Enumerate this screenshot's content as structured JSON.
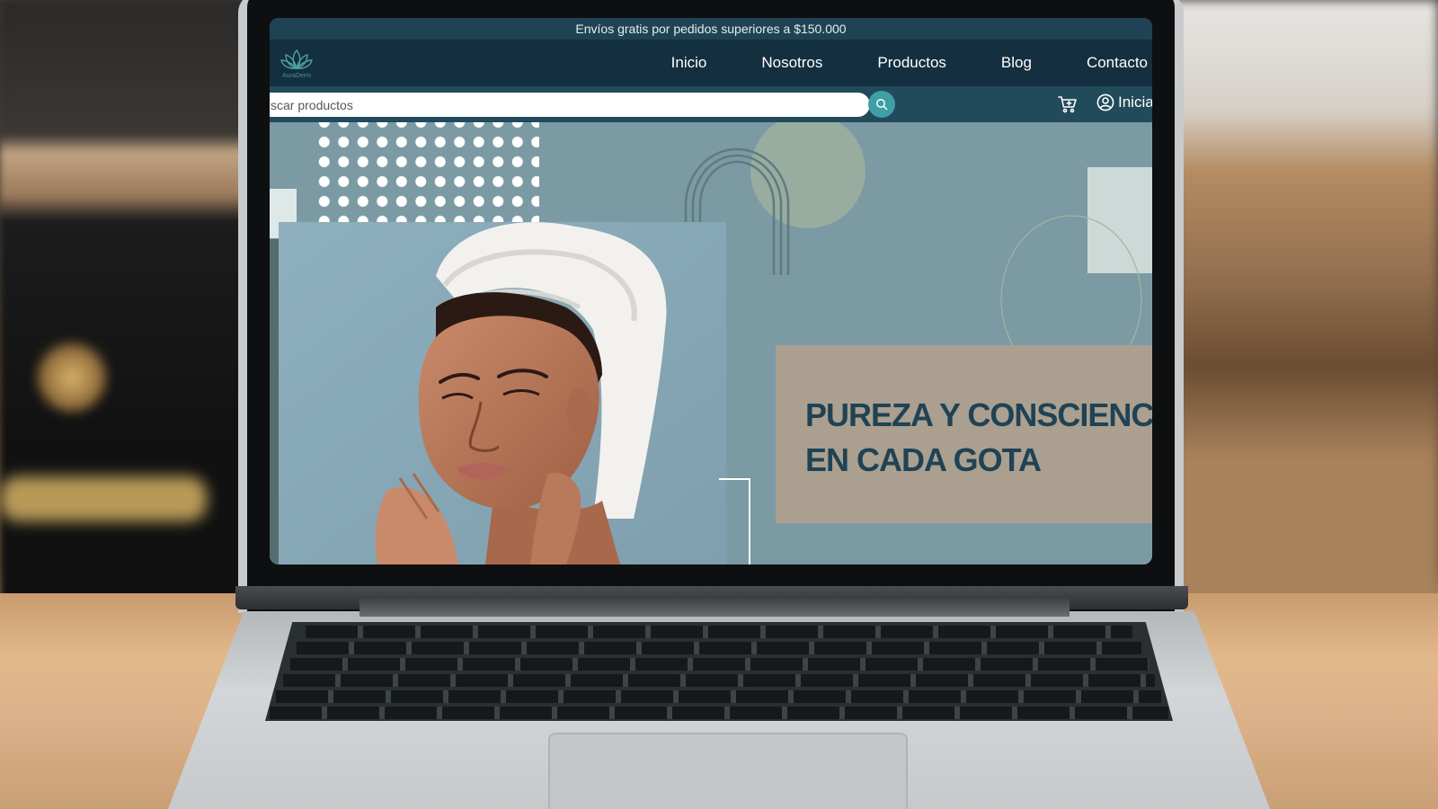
{
  "promo": {
    "text": "Envíos gratis por pedidos superiores a $150.000"
  },
  "brand": {
    "logo_text": "AuraDerm"
  },
  "nav": {
    "items": [
      "Inicio",
      "Nosotros",
      "Productos",
      "Blog",
      "Contacto"
    ]
  },
  "search": {
    "placeholder": "scar productos"
  },
  "account": {
    "login_label": "Inicia"
  },
  "hero": {
    "title_line1": "PUREZA Y CONSCIENCIA",
    "title_line2": "EN CADA GOTA"
  },
  "colors": {
    "promo_bar": "#1f4355",
    "navbar": "#142f40",
    "search_bar": "#214a5a",
    "accent": "#3f9ea6",
    "hero_bg": "#7b9aa3",
    "hero_box": "#ab9f8f",
    "title": "#1f4355"
  },
  "icons": [
    "lotus-logo-icon",
    "search-icon",
    "cart-icon",
    "user-icon"
  ]
}
